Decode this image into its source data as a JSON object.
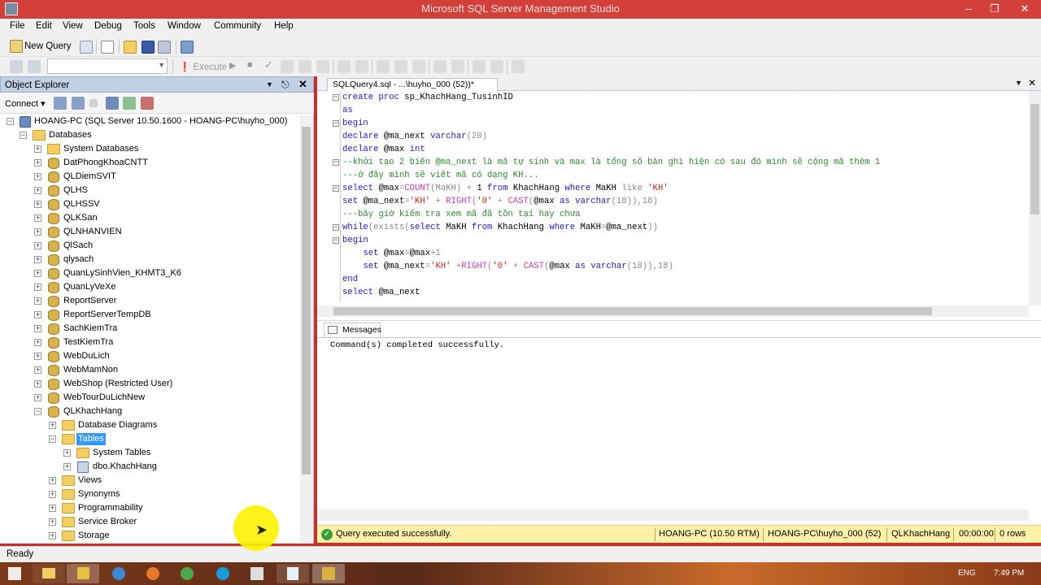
{
  "window": {
    "title": "Microsoft SQL Server Management Studio"
  },
  "menu": [
    "File",
    "Edit",
    "View",
    "Debug",
    "Tools",
    "Window",
    "Community",
    "Help"
  ],
  "toolbar": {
    "new_query": "New Query",
    "execute": "Execute"
  },
  "object_explorer": {
    "title": "Object Explorer",
    "connect": "Connect",
    "server": "HOANG-PC (SQL Server 10.50.1600 - HOANG-PC\\huyho_000)",
    "databases_label": "Databases",
    "databases": [
      "System Databases",
      "DatPhongKhoaCNTT",
      "QLDiemSVIT",
      "QLHS",
      "QLHSSV",
      "QLKSan",
      "QLNHANVIEN",
      "QlSach",
      "qlysach",
      "QuanLySinhVien_KHMT3_K6",
      "QuanLyVeXe",
      "ReportServer",
      "ReportServerTempDB",
      "SachKiemTra",
      "TestKiemTra",
      "WebDuLich",
      "WebMamNon",
      "WebShop (Restricted User)",
      "WebTourDuLichNew",
      "QLKhachHang"
    ],
    "qlkh_children": [
      "Database Diagrams",
      "Tables",
      "System Tables",
      "dbo.KhachHang",
      "Views",
      "Synonyms",
      "Programmability",
      "Service Broker",
      "Storage"
    ]
  },
  "editor": {
    "tab": "SQLQuery4.sql - ...\\huyho_000 (52))*",
    "lines": [
      [
        {
          "c": "kw",
          "t": "create proc "
        },
        {
          "c": "",
          "t": "sp_KhachHang_TusinhID"
        }
      ],
      [
        {
          "c": "kw",
          "t": "as"
        }
      ],
      [
        {
          "c": "kw",
          "t": "begin"
        }
      ],
      [
        {
          "c": "kw",
          "t": "declare "
        },
        {
          "c": "",
          "t": "@ma_next "
        },
        {
          "c": "kw",
          "t": "varchar"
        },
        {
          "c": "gy",
          "t": "(20)"
        }
      ],
      [
        {
          "c": "kw",
          "t": "declare "
        },
        {
          "c": "",
          "t": "@max "
        },
        {
          "c": "kw",
          "t": "int"
        }
      ],
      [
        {
          "c": "cm",
          "t": "--khởi tạo 2 biến @ma_next là mã tự sinh và max là tổng số bản ghi hiện có sau đó mình sẽ cộng mã thêm 1"
        }
      ],
      [
        {
          "c": "cm",
          "t": "---ở đây mình sẽ viết mã có dạng KH..."
        }
      ],
      [
        {
          "c": "kw",
          "t": "select "
        },
        {
          "c": "",
          "t": "@max"
        },
        {
          "c": "gy",
          "t": "="
        },
        {
          "c": "fn",
          "t": "COUNT"
        },
        {
          "c": "gy",
          "t": "(MaKH) + "
        },
        {
          "c": "",
          "t": "1 "
        },
        {
          "c": "kw",
          "t": "from "
        },
        {
          "c": "",
          "t": "KhachHang "
        },
        {
          "c": "kw",
          "t": "where "
        },
        {
          "c": "",
          "t": "MaKH "
        },
        {
          "c": "gy",
          "t": "like "
        },
        {
          "c": "st",
          "t": "'KH'"
        }
      ],
      [
        {
          "c": "kw",
          "t": "set "
        },
        {
          "c": "",
          "t": "@ma_next"
        },
        {
          "c": "gy",
          "t": "="
        },
        {
          "c": "st",
          "t": "'KH'"
        },
        {
          "c": "gy",
          "t": " + "
        },
        {
          "c": "fn",
          "t": "RIGHT"
        },
        {
          "c": "gy",
          "t": "("
        },
        {
          "c": "st",
          "t": "'0'"
        },
        {
          "c": "gy",
          "t": " + "
        },
        {
          "c": "fn",
          "t": "CAST"
        },
        {
          "c": "gy",
          "t": "("
        },
        {
          "c": "",
          "t": "@max "
        },
        {
          "c": "kw",
          "t": "as varchar"
        },
        {
          "c": "gy",
          "t": "(18)),18)"
        }
      ],
      [
        {
          "c": "cm",
          "t": "---bây giờ kiểm tra xem mã đã tồn tại hay chưa"
        }
      ],
      [
        {
          "c": "kw",
          "t": "while"
        },
        {
          "c": "gy",
          "t": "(exists("
        },
        {
          "c": "kw",
          "t": "select "
        },
        {
          "c": "",
          "t": "MaKH "
        },
        {
          "c": "kw",
          "t": "from "
        },
        {
          "c": "",
          "t": "KhachHang "
        },
        {
          "c": "kw",
          "t": "where "
        },
        {
          "c": "",
          "t": "MaKH"
        },
        {
          "c": "gy",
          "t": "="
        },
        {
          "c": "",
          "t": "@ma_next"
        },
        {
          "c": "gy",
          "t": "))"
        }
      ],
      [
        {
          "c": "kw",
          "t": "begin"
        }
      ],
      [
        {
          "c": "",
          "t": "    "
        },
        {
          "c": "kw",
          "t": "set "
        },
        {
          "c": "",
          "t": "@max"
        },
        {
          "c": "gy",
          "t": "="
        },
        {
          "c": "",
          "t": "@max"
        },
        {
          "c": "gy",
          "t": "+1"
        }
      ],
      [
        {
          "c": "",
          "t": "    "
        },
        {
          "c": "kw",
          "t": "set "
        },
        {
          "c": "",
          "t": "@ma_next"
        },
        {
          "c": "gy",
          "t": "="
        },
        {
          "c": "st",
          "t": "'KH'"
        },
        {
          "c": "gy",
          "t": " +"
        },
        {
          "c": "fn",
          "t": "RIGHT"
        },
        {
          "c": "gy",
          "t": "("
        },
        {
          "c": "st",
          "t": "'0'"
        },
        {
          "c": "gy",
          "t": " + "
        },
        {
          "c": "fn",
          "t": "CAST"
        },
        {
          "c": "gy",
          "t": "("
        },
        {
          "c": "",
          "t": "@max "
        },
        {
          "c": "kw",
          "t": "as varchar"
        },
        {
          "c": "gy",
          "t": "(18)),18)"
        }
      ],
      [
        {
          "c": "kw",
          "t": "end"
        }
      ],
      [
        {
          "c": "kw",
          "t": "select "
        },
        {
          "c": "",
          "t": "@ma_next"
        }
      ]
    ]
  },
  "results": {
    "tab": "Messages",
    "message": "Command(s) completed successfully."
  },
  "query_status": {
    "message": "Query executed successfully.",
    "server": "HOANG-PC (10.50 RTM)",
    "user": "HOANG-PC\\huyho_000 (52)",
    "database": "QLKhachHang",
    "elapsed": "00:00:00",
    "rows": "0 rows"
  },
  "status_bar": {
    "text": "Ready"
  },
  "taskbar": {
    "lang": "ENG",
    "time": "7:49 PM"
  },
  "colors": {
    "accent": "#d3403a",
    "panel_title": "#c2d0e6",
    "status_yellow": "#fff2a8"
  }
}
